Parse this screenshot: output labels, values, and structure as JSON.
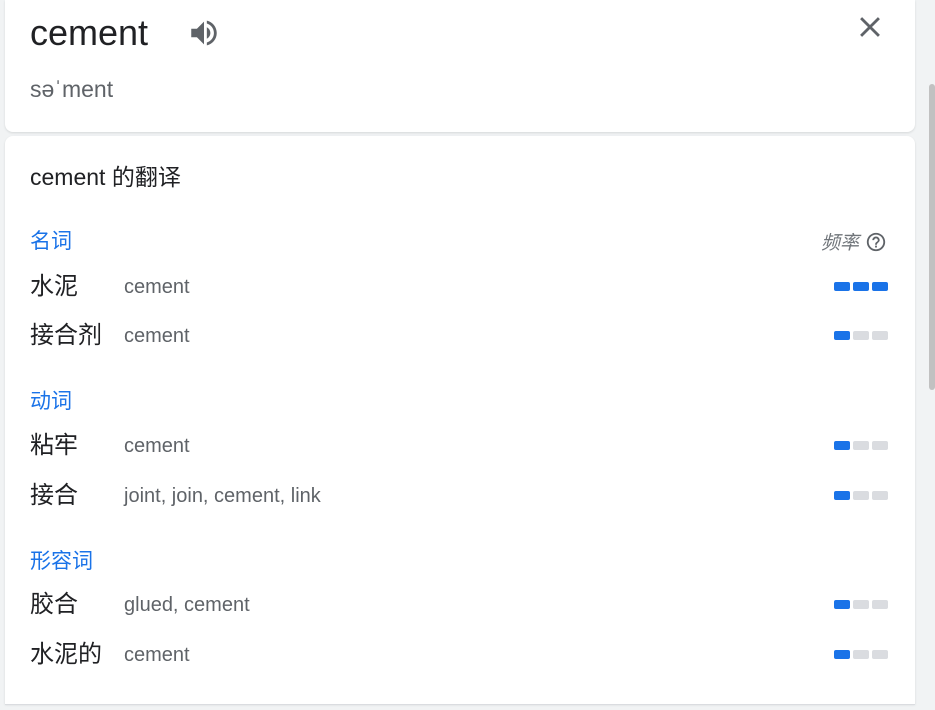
{
  "header": {
    "word": "cement",
    "phonetic": "səˈment",
    "speaker_icon": "speaker-icon",
    "close_icon": "close-icon"
  },
  "translations": {
    "heading": "cement 的翻译",
    "frequency_label": "频率",
    "help_icon": "help-circle-icon",
    "accent_color": "#1a73e8",
    "groups": [
      {
        "pos": "名词",
        "entries": [
          {
            "term": "水泥",
            "synonyms": "cement",
            "frequency": 3
          },
          {
            "term": "接合剂",
            "synonyms": "cement",
            "frequency": 1
          }
        ]
      },
      {
        "pos": "动词",
        "entries": [
          {
            "term": "粘牢",
            "synonyms": "cement",
            "frequency": 1
          },
          {
            "term": "接合",
            "synonyms": "joint, join, cement, link",
            "frequency": 1
          }
        ]
      },
      {
        "pos": "形容词",
        "entries": [
          {
            "term": "胶合",
            "synonyms": "glued, cement",
            "frequency": 1
          },
          {
            "term": "水泥的",
            "synonyms": "cement",
            "frequency": 1
          }
        ]
      }
    ]
  }
}
